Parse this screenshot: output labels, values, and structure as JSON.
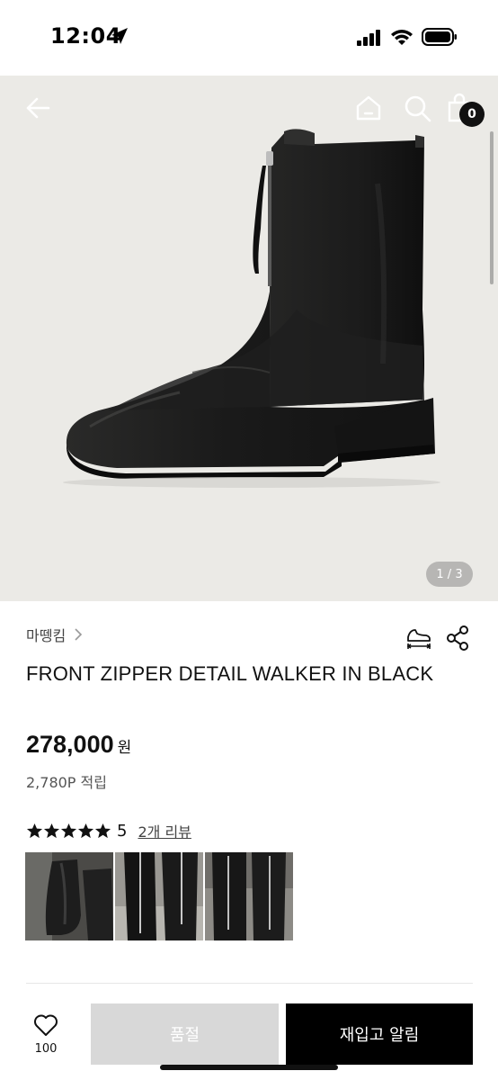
{
  "status_bar": {
    "time": "12:04",
    "icons": [
      "location-arrow-icon",
      "cellular-signal-icon",
      "wifi-icon",
      "battery-icon"
    ]
  },
  "header": {
    "icons": [
      "back-arrow-icon",
      "home-icon",
      "search-icon",
      "shopping-bag-icon"
    ],
    "cart_count": "0"
  },
  "gallery": {
    "page_indicator": "1 / 3"
  },
  "product": {
    "brand": "마뗑킴",
    "title": "FRONT ZIPPER DETAIL WALKER IN BLACK",
    "price": "278,000",
    "price_unit": "원",
    "points": "2,780P 적립",
    "rating_score": "5",
    "rating_stars": 5,
    "review_link": "2개 리뷰",
    "review_thumbnail_count": 3
  },
  "bottom_bar": {
    "like_count": "100",
    "soldout_label": "품절",
    "restock_label": "재입고 알림"
  },
  "colors": {
    "accent": "#000000",
    "hero_bg": "#ebeae6",
    "soldout_bg": "#d8d8d8"
  }
}
